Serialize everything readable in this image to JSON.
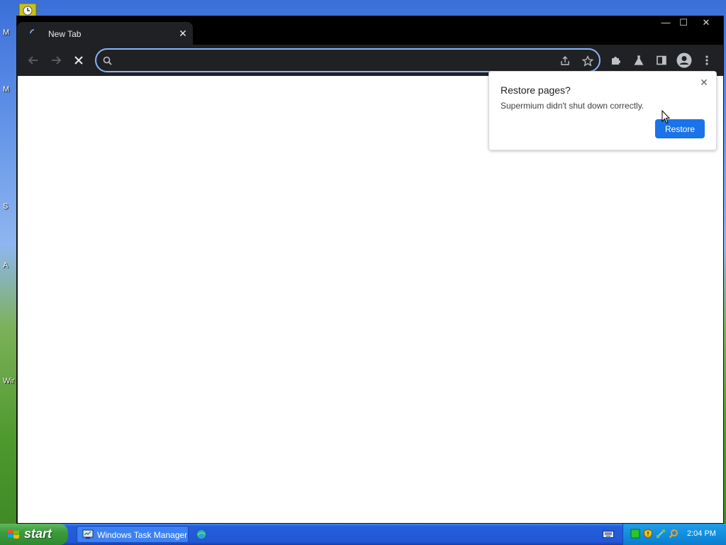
{
  "desktop": {
    "labels": [
      "M",
      "M",
      "S",
      "A",
      "Wir"
    ]
  },
  "browser": {
    "tab": {
      "title": "New Tab",
      "close_glyph": "✕"
    },
    "window_controls": {
      "minimize": "—",
      "maximize": "☐",
      "close": "✕"
    },
    "omnibox": {
      "value": "",
      "placeholder": ""
    }
  },
  "popup": {
    "title": "Restore pages?",
    "message": "Supermium didn't shut down correctly.",
    "restore_label": "Restore",
    "close_glyph": "✕"
  },
  "taskbar": {
    "start_label": "start",
    "task_item_label": "Windows Task Manager",
    "clock": "2:04 PM"
  },
  "colors": {
    "accent": "#1a73e8",
    "focus_ring": "#8ab4f8",
    "dark_toolbar": "#202124"
  }
}
